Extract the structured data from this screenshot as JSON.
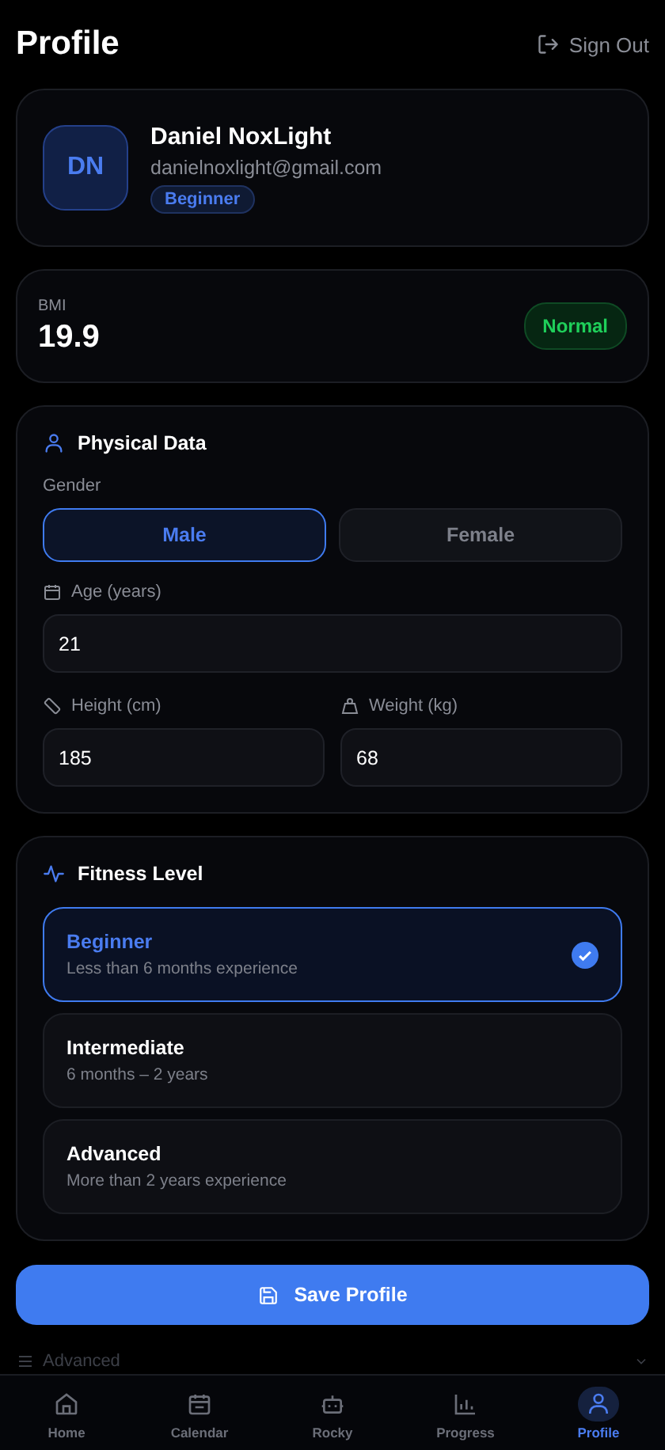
{
  "header": {
    "title": "Profile",
    "sign_out": "Sign Out"
  },
  "profile": {
    "initials": "DN",
    "name": "Daniel NoxLight",
    "email": "danielnoxlight@gmail.com",
    "badge": "Beginner"
  },
  "bmi": {
    "label": "BMI",
    "value": "19.9",
    "status": "Normal"
  },
  "physical_data": {
    "title": "Physical Data",
    "gender_label": "Gender",
    "gender_options": [
      {
        "label": "Male",
        "selected": true
      },
      {
        "label": "Female",
        "selected": false
      }
    ],
    "age": {
      "label": "Age (years)",
      "value": "21"
    },
    "height": {
      "label": "Height (cm)",
      "value": "185"
    },
    "weight": {
      "label": "Weight (kg)",
      "value": "68"
    }
  },
  "fitness_level": {
    "title": "Fitness Level",
    "options": [
      {
        "title": "Beginner",
        "description": "Less than 6 months experience",
        "selected": true
      },
      {
        "title": "Intermediate",
        "description": "6 months – 2 years",
        "selected": false
      },
      {
        "title": "Advanced",
        "description": "More than 2 years experience",
        "selected": false
      }
    ]
  },
  "save_button": "Save Profile",
  "advanced": {
    "label": "Advanced",
    "expanded": false
  },
  "nav": [
    {
      "label": "Home",
      "selected": false
    },
    {
      "label": "Calendar",
      "selected": false
    },
    {
      "label": "Rocky",
      "selected": false
    },
    {
      "label": "Progress",
      "selected": false
    },
    {
      "label": "Profile",
      "selected": true
    }
  ]
}
